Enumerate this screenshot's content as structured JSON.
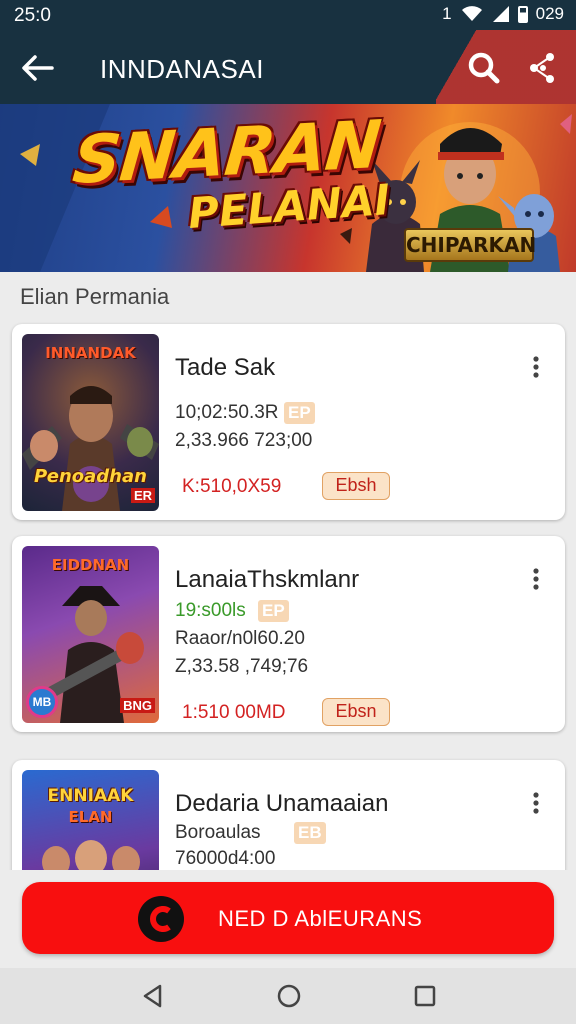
{
  "status_bar": {
    "time": "25:0",
    "signal_glyph": "1",
    "time_right": "029"
  },
  "app_bar": {
    "title": "INNDANASAI",
    "colors": {
      "background": "#183140",
      "accent": "#c9352e"
    }
  },
  "banner": {
    "title": "SNARAN",
    "subtitle": "PELANAI",
    "badge": "CHIPARKAN"
  },
  "section": {
    "title": "Elian Permania"
  },
  "cards": [
    {
      "title": "Tade Sak",
      "line1": "10;02:50.3R",
      "line1_tag": "EP",
      "line2": "2,33.966 723;00",
      "price": "K:510,0X59",
      "action": "Ebsh",
      "thumb_title": "INNANDAK",
      "thumb_subtitle": "Penoadhan",
      "thumb_badge": "ER"
    },
    {
      "title": "LanaiaThskmlanr",
      "line1": "19:s00ls",
      "line1_tag": "EP",
      "line2": "Raaor/n0l60.20",
      "line3": "Z,33.58 ,749;76",
      "price": "1:510 00MD",
      "action": "Ebsn",
      "thumb_title": "EIDDNAN",
      "thumb_badge": "BNG",
      "thumb_logo": "MB"
    },
    {
      "title": "Dedaria Unamaaian",
      "line1": "Boroaulas",
      "line1_tag": "EB",
      "line2": "76000d4:00",
      "thumb_title": "ENNIAAK",
      "thumb_subtitle": "ELAN"
    }
  ],
  "cta": {
    "label": "NED D AblEURANS",
    "color": "#f80f0f"
  },
  "icons": {
    "back": "arrow-left-icon",
    "search": "search-icon",
    "share": "share-icon",
    "more": "more-vertical-icon",
    "nav_back": "triangle-back-icon",
    "nav_home": "circle-home-icon",
    "nav_recent": "square-recent-icon"
  }
}
